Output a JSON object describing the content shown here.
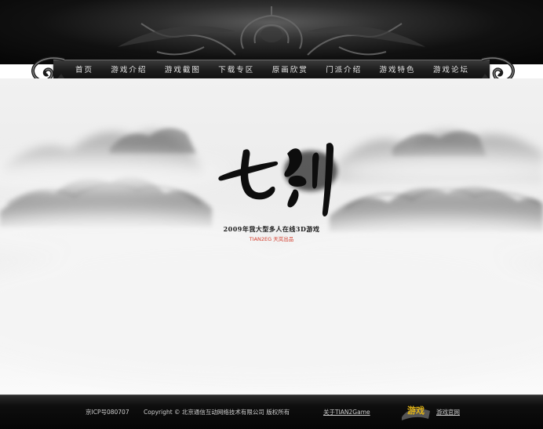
{
  "nav": {
    "items": [
      {
        "label": "首页"
      },
      {
        "label": "游戏介绍"
      },
      {
        "label": "游戏截图"
      },
      {
        "label": "下载专区"
      },
      {
        "label": "原画欣赏"
      },
      {
        "label": "门派介绍"
      },
      {
        "label": "游戏特色"
      },
      {
        "label": "游戏论坛"
      }
    ]
  },
  "hero": {
    "logo_text": "七剑",
    "tagline": "2009年我大型多人在线3D游戏",
    "subtag": "TIAN2EG 天岚出品"
  },
  "footer": {
    "icp": "京ICP号080707",
    "copyright": "Copyright © 北京通信互动网络技术有限公司 版权所有",
    "about": "关于TIAN2Game",
    "publisher_logo": "游戏",
    "official_site": "游戏官网"
  },
  "colors": {
    "banner_dark": "#111111",
    "mist": "#f0f0f0",
    "subtag_red": "#d23c2c",
    "logo_gold": "#e2b417"
  }
}
